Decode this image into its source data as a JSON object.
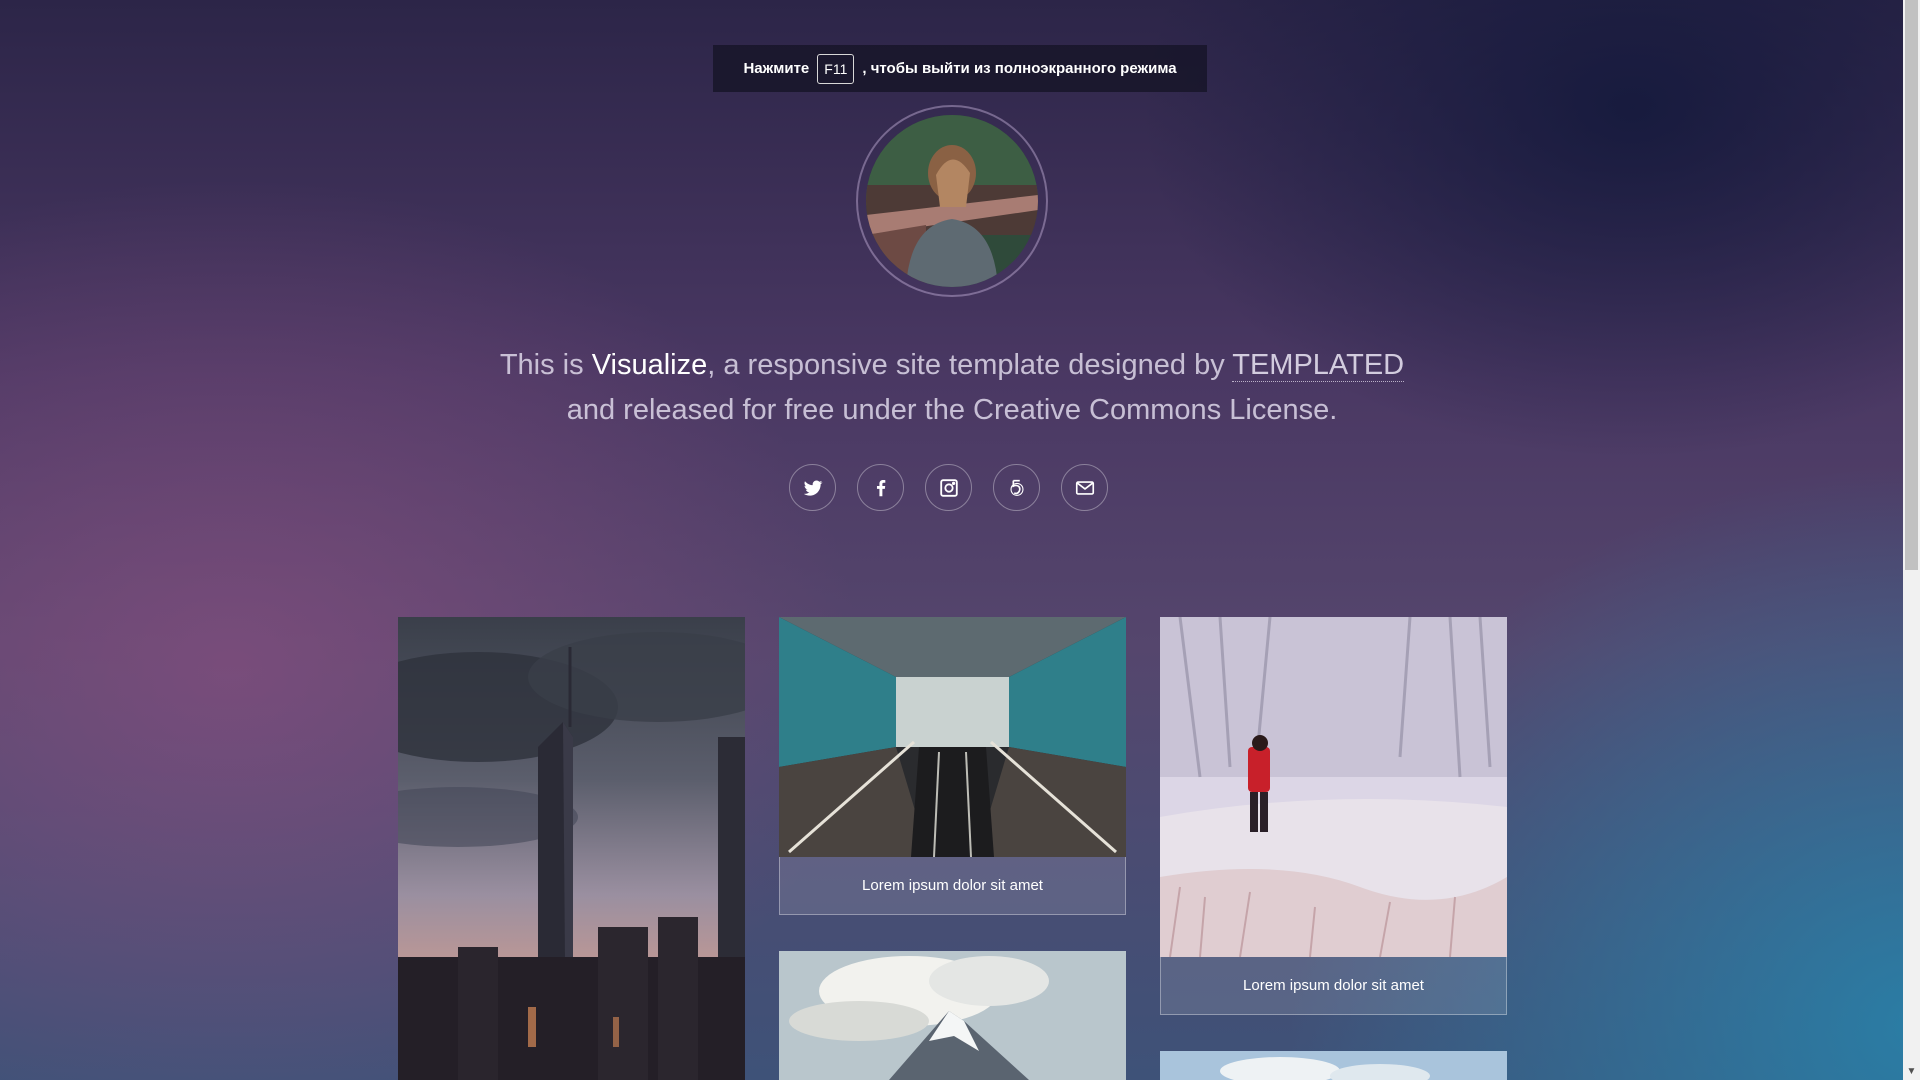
{
  "fullscreen_notice": {
    "before": "Нажмите",
    "key": "F11",
    "after": ", чтобы выйти из полноэкранного режима"
  },
  "intro": {
    "part1": "This is ",
    "brand": "Visualize",
    "part2": ", a responsive site template designed by ",
    "author": "TEMPLATED",
    "part3": "and released for free under the Creative Commons License."
  },
  "social": [
    {
      "icon": "twitter-icon"
    },
    {
      "icon": "facebook-icon"
    },
    {
      "icon": "instagram-icon"
    },
    {
      "icon": "500px-icon"
    },
    {
      "icon": "envelope-icon"
    }
  ],
  "gallery": [
    {
      "subject": "skyscraper at dusk",
      "caption": ""
    },
    {
      "subject": "escalators in station",
      "caption": "Lorem ipsum dolor sit amet"
    },
    {
      "subject": "person in red coat in snowy field",
      "caption": "Lorem ipsum dolor sit amet"
    },
    {
      "subject": "snowy mountain peak",
      "caption": ""
    },
    {
      "subject": "landscape",
      "caption": ""
    }
  ],
  "colors": {
    "accent_text": "#ffffff",
    "notice_bg": "#18162a"
  }
}
